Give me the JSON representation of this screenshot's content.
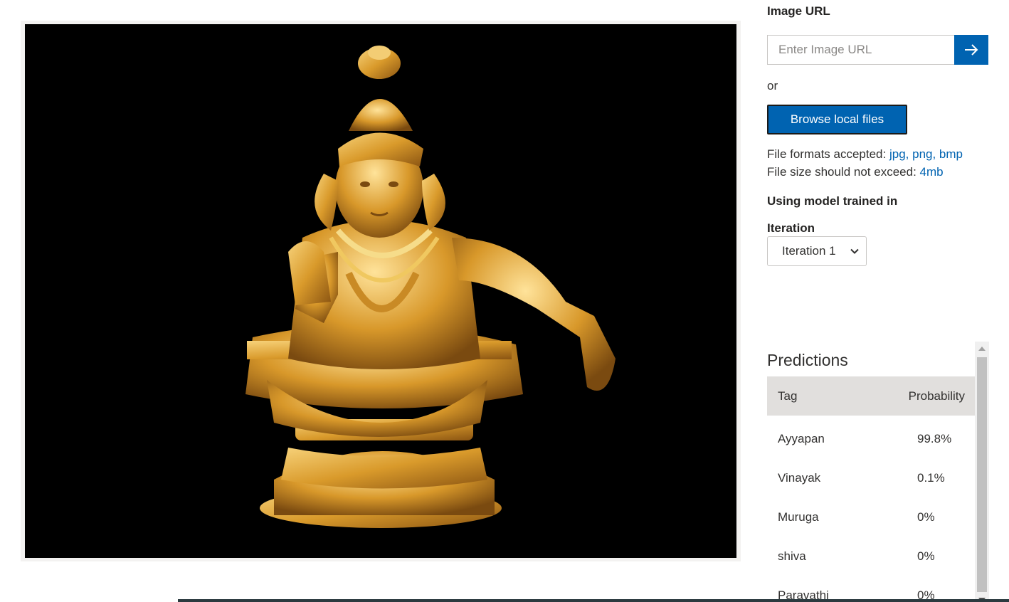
{
  "image_url": {
    "label": "Image URL",
    "placeholder": "Enter Image URL",
    "submit_icon": "arrow-right-icon"
  },
  "or_text": "or",
  "browse_label": "Browse local files",
  "file_formats": {
    "label": "File formats accepted:",
    "value": "jpg, png, bmp"
  },
  "file_size": {
    "label": "File size should not exceed:",
    "value": "4mb"
  },
  "model_label": "Using model trained in",
  "iteration": {
    "label": "Iteration",
    "selected": "Iteration 1"
  },
  "predictions": {
    "title": "Predictions",
    "columns": [
      "Tag",
      "Probability"
    ],
    "rows": [
      {
        "tag": "Ayyapan",
        "probability": "99.8%"
      },
      {
        "tag": "Vinayak",
        "probability": "0.1%"
      },
      {
        "tag": "Muruga",
        "probability": "0%"
      },
      {
        "tag": "shiva",
        "probability": "0%"
      },
      {
        "tag": "Paravathi",
        "probability": "0%"
      }
    ]
  },
  "colors": {
    "accent": "#0063b1",
    "image_background": "#000000",
    "table_header": "#e1dfdd"
  }
}
